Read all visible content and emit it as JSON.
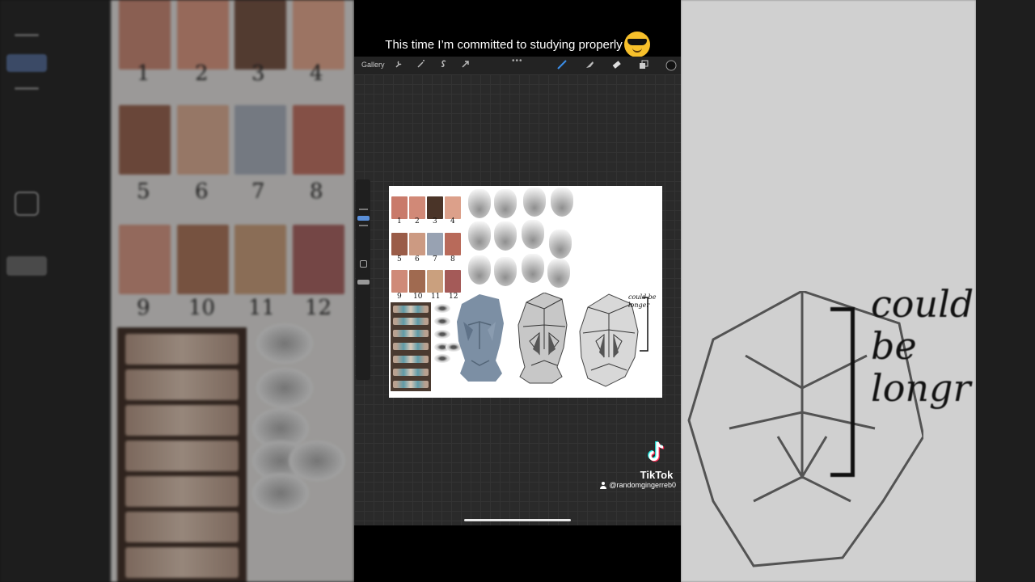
{
  "caption": {
    "text": "This time I’m committed to studying properly",
    "emoji": "smiling-face-with-sunglasses"
  },
  "procreate": {
    "toolbar": {
      "gallery_label": "Gallery",
      "tools_left": [
        "wrench-icon",
        "magic-wand-icon",
        "selection-icon",
        "transform-arrow-icon"
      ],
      "tools_right": [
        "brush-icon",
        "smudge-icon",
        "eraser-icon",
        "layers-icon",
        "color-picker-icon"
      ],
      "more_label": "•••"
    },
    "artwork": {
      "nose_numbers": [
        "1",
        "2",
        "3",
        "4",
        "5",
        "6",
        "7",
        "8",
        "9",
        "10",
        "11",
        "12"
      ],
      "annotation": "could be longer"
    }
  },
  "background_right": {
    "annotation_lines": [
      "could",
      "be",
      "longr"
    ]
  },
  "watermark": {
    "brand": "TikTok",
    "handle": "@randomgingerreb0"
  },
  "colors": {
    "accent_blue": "#3b8ee8",
    "caption_text": "#ffffff",
    "toolbar_bg": "#232323",
    "canvas_bg": "#2a2a2a"
  }
}
